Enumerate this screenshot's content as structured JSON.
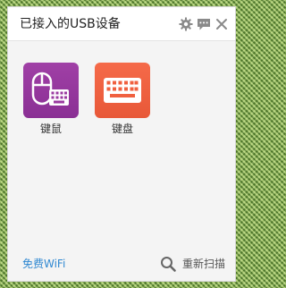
{
  "header": {
    "title": "已接入的USB设备",
    "icons": [
      "gear-icon",
      "chat-icon",
      "close-icon"
    ]
  },
  "devices": [
    {
      "label": "键鼠",
      "icon": "mouse-keyboard-icon",
      "color": "#9a3aa0"
    },
    {
      "label": "键盘",
      "icon": "keyboard-icon",
      "color": "#f0603f"
    }
  ],
  "footer": {
    "wifi_link": "免费WiFi",
    "rescan_label": "重新扫描",
    "link_color": "#2f88d1"
  }
}
